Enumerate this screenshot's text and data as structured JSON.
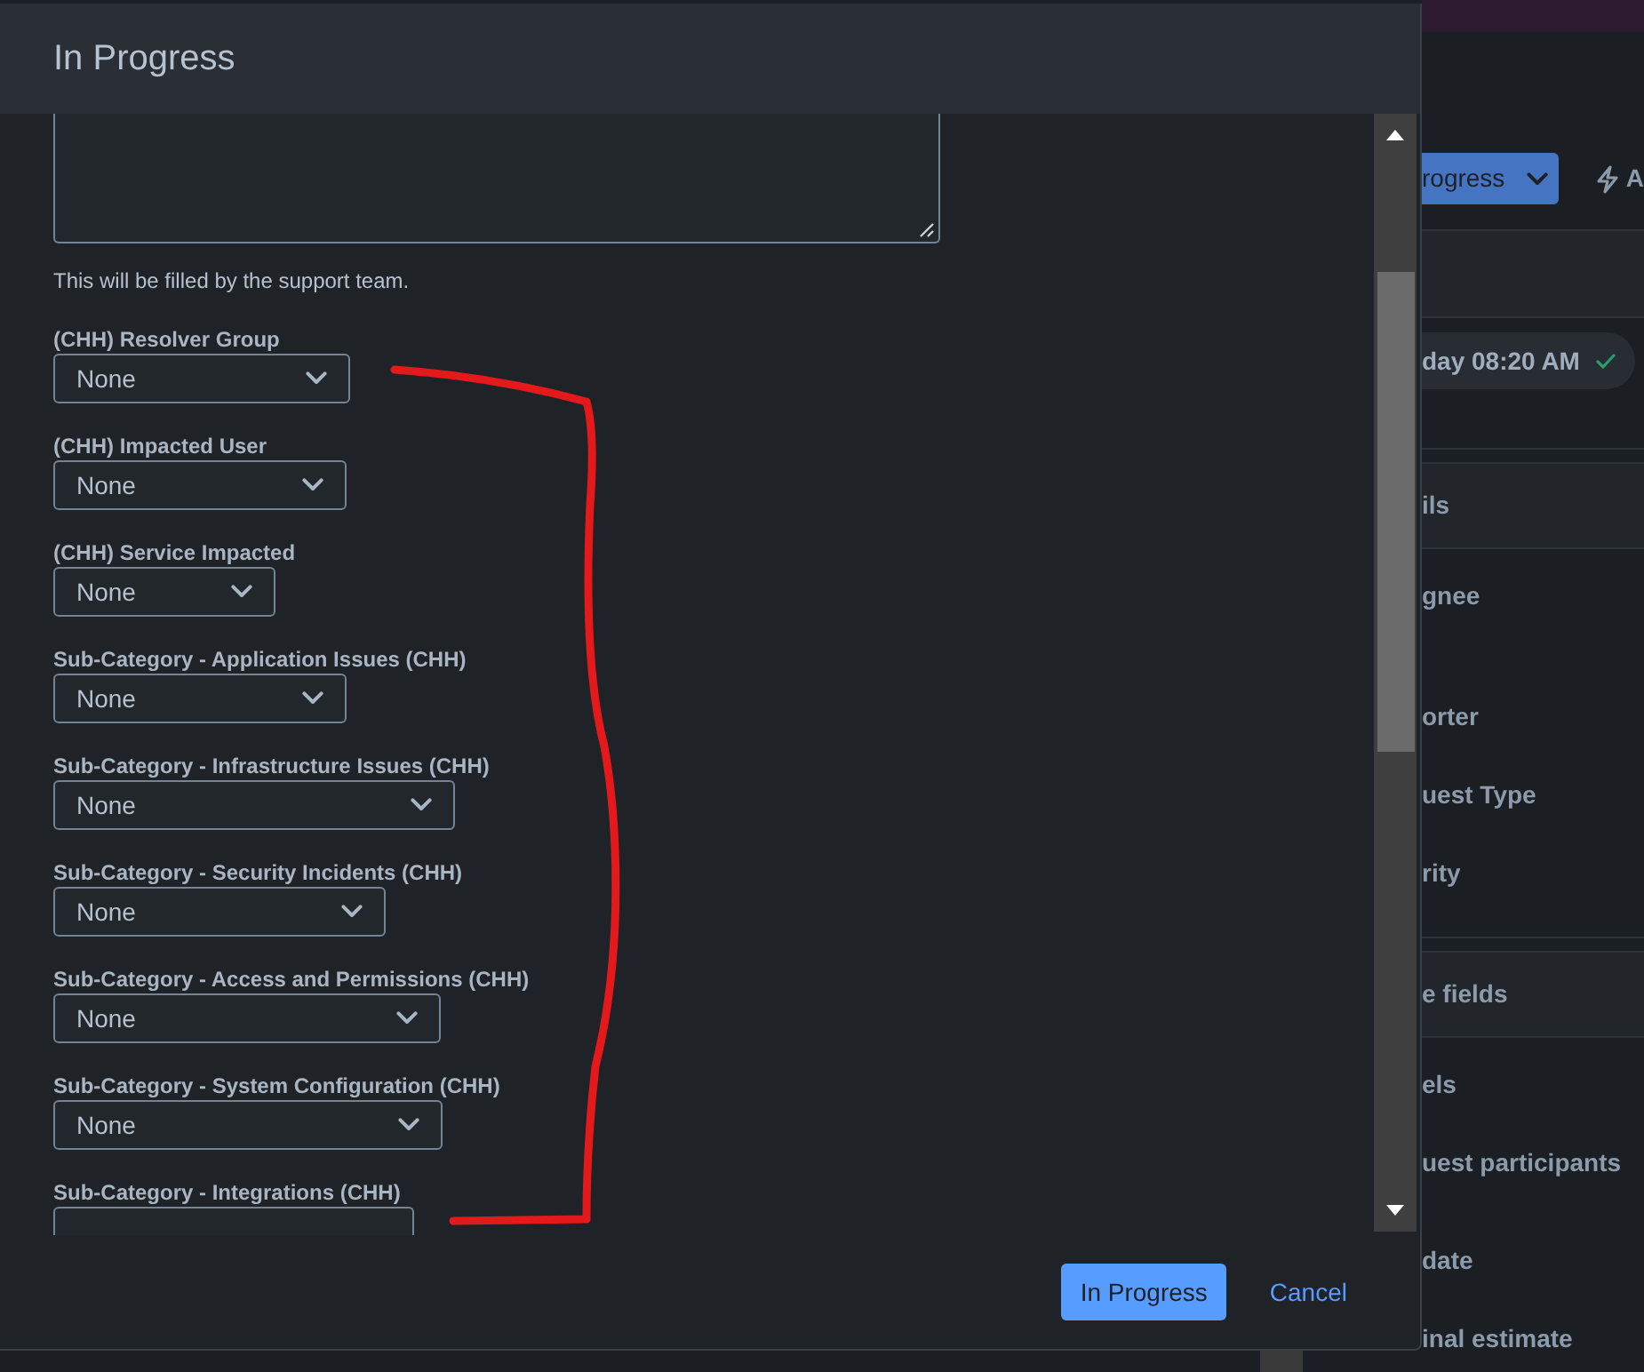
{
  "dialog": {
    "title": "In Progress",
    "description": {
      "helper_text": "This will be filled by the support team."
    },
    "fields": [
      {
        "label": "(CHH) Resolver Group",
        "value": "None"
      },
      {
        "label": "(CHH) Impacted User",
        "value": "None"
      },
      {
        "label": "(CHH) Service Impacted",
        "value": "None"
      },
      {
        "label": "Sub-Category - Application Issues (CHH)",
        "value": "None"
      },
      {
        "label": "Sub-Category - Infrastructure Issues (CHH)",
        "value": "None"
      },
      {
        "label": "Sub-Category - Security Incidents (CHH)",
        "value": "None"
      },
      {
        "label": "Sub-Category - Access and Permissions (CHH)",
        "value": "None"
      },
      {
        "label": "Sub-Category - System Configuration (CHH)",
        "value": "None"
      },
      {
        "label": "Sub-Category - Integrations (CHH)"
      }
    ],
    "buttons": [
      {
        "kind": "primary",
        "label": "In Progress"
      },
      {
        "kind": "link",
        "label": "Cancel"
      }
    ]
  },
  "background_page": {
    "status_button": {
      "label": "rogress"
    },
    "action_button": {
      "label": "A"
    },
    "timestamp": {
      "text": "day 08:20 AM"
    },
    "sections": [
      {
        "title": "ils",
        "fields": [
          "gnee",
          "orter",
          "uest Type",
          "rity"
        ]
      },
      {
        "title": "e fields",
        "fields": [
          "els",
          "uest participants",
          "date",
          "inal estimate"
        ]
      }
    ]
  }
}
